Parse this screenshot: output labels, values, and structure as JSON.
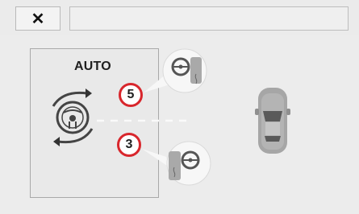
{
  "toolbar": {
    "close_glyph": "✕",
    "title_value": ""
  },
  "panel": {
    "mode_label": "AUTO"
  },
  "positions": {
    "upper_number": "5",
    "lower_number": "3"
  },
  "colors": {
    "badge_ring": "#d8262c",
    "panel_border": "#a9a9a9"
  },
  "icons": [
    "close-icon",
    "steering-wheel-rotate-icon",
    "steering-wheel-seat-icon",
    "car-top-view-icon",
    "heat-icon"
  ]
}
